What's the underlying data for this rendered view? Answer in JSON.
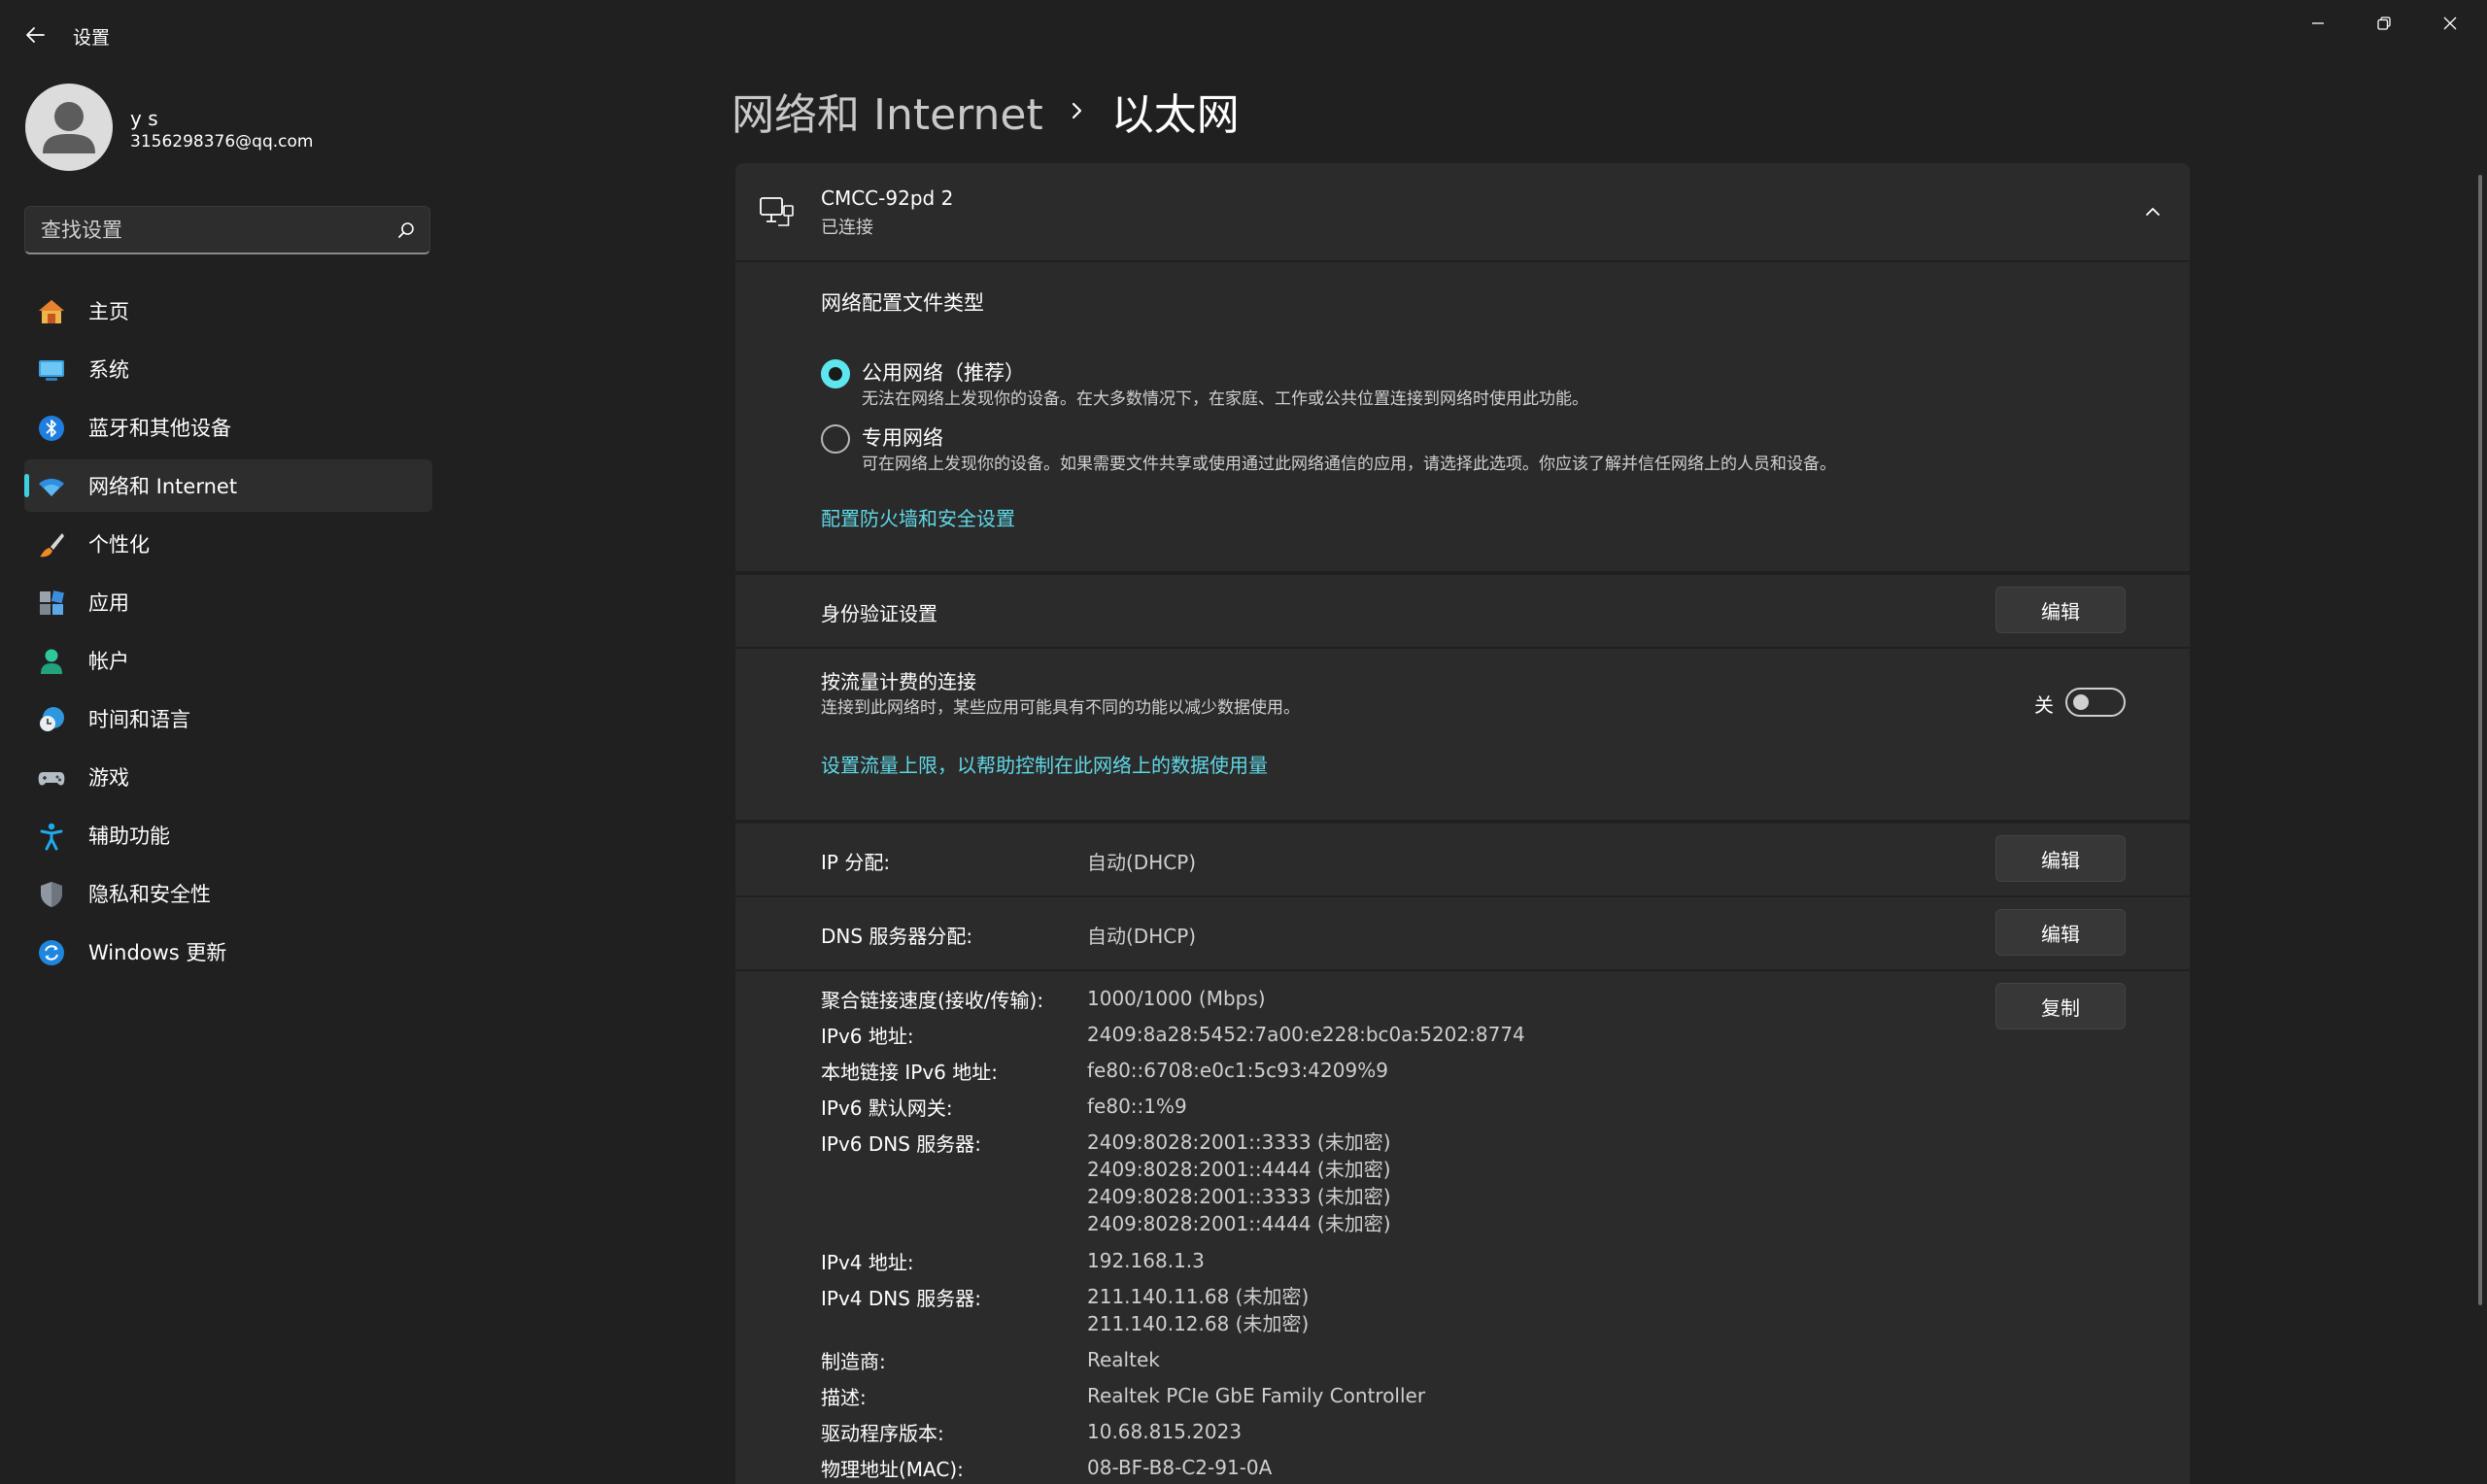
{
  "window": {
    "title": "设置"
  },
  "user": {
    "name": "y s",
    "email": "3156298376@qq.com"
  },
  "search": {
    "placeholder": "查找设置"
  },
  "sidebar": {
    "items": [
      {
        "label": "主页",
        "icon": "home-icon"
      },
      {
        "label": "系统",
        "icon": "system-icon"
      },
      {
        "label": "蓝牙和其他设备",
        "icon": "bluetooth-icon"
      },
      {
        "label": "网络和 Internet",
        "icon": "wifi-icon",
        "active": true
      },
      {
        "label": "个性化",
        "icon": "brush-icon"
      },
      {
        "label": "应用",
        "icon": "apps-icon"
      },
      {
        "label": "帐户",
        "icon": "account-icon"
      },
      {
        "label": "时间和语言",
        "icon": "clock-globe-icon"
      },
      {
        "label": "游戏",
        "icon": "gamepad-icon"
      },
      {
        "label": "辅助功能",
        "icon": "accessibility-icon"
      },
      {
        "label": "隐私和安全性",
        "icon": "shield-icon"
      },
      {
        "label": "Windows 更新",
        "icon": "update-icon"
      }
    ]
  },
  "breadcrumb": {
    "parent": "网络和 Internet",
    "current": "以太网"
  },
  "adapter": {
    "name": "CMCC-92pd 2",
    "status": "已连接"
  },
  "profile": {
    "title": "网络配置文件类型",
    "options": [
      {
        "label": "公用网络（推荐）",
        "desc": "无法在网络上发现你的设备。在大多数情况下，在家庭、工作或公共位置连接到网络时使用此功能。",
        "selected": true
      },
      {
        "label": "专用网络",
        "desc": "可在网络上发现你的设备。如果需要文件共享或使用通过此网络通信的应用，请选择此选项。你应该了解并信任网络上的人员和设备。",
        "selected": false
      }
    ],
    "firewall_link": "配置防火墙和安全设置"
  },
  "auth": {
    "label": "身份验证设置",
    "button": "编辑"
  },
  "metered": {
    "label": "按流量计费的连接",
    "desc": "连接到此网络时，某些应用可能具有不同的功能以减少数据使用。",
    "state_label": "关",
    "on": false,
    "link": "设置流量上限，以帮助控制在此网络上的数据使用量"
  },
  "ip": {
    "label": "IP 分配:",
    "value": "自动(DHCP)",
    "button": "编辑"
  },
  "dns": {
    "label": "DNS 服务器分配:",
    "value": "自动(DHCP)",
    "button": "编辑"
  },
  "properties": {
    "copy_button": "复制",
    "rows": [
      {
        "key": "聚合链接速度(接收/传输):",
        "values": [
          "1000/1000 (Mbps)"
        ]
      },
      {
        "key": "IPv6 地址:",
        "values": [
          "2409:8a28:5452:7a00:e228:bc0a:5202:8774"
        ]
      },
      {
        "key": "本地链接 IPv6 地址:",
        "values": [
          "fe80::6708:e0c1:5c93:4209%9"
        ]
      },
      {
        "key": "IPv6 默认网关:",
        "values": [
          "fe80::1%9"
        ]
      },
      {
        "key": "IPv6 DNS 服务器:",
        "values": [
          "2409:8028:2001::3333 (未加密)",
          "2409:8028:2001::4444 (未加密)",
          "2409:8028:2001::3333 (未加密)",
          "2409:8028:2001::4444 (未加密)"
        ]
      },
      {
        "key": "IPv4 地址:",
        "values": [
          "192.168.1.3"
        ]
      },
      {
        "key": "IPv4 DNS 服务器:",
        "values": [
          "211.140.11.68 (未加密)",
          "211.140.12.68 (未加密)"
        ]
      },
      {
        "key": "制造商:",
        "values": [
          "Realtek"
        ]
      },
      {
        "key": "描述:",
        "values": [
          "Realtek PCIe GbE Family Controller"
        ]
      },
      {
        "key": "驱动程序版本:",
        "values": [
          "10.68.815.2023"
        ]
      },
      {
        "key": "物理地址(MAC):",
        "values": [
          "08-BF-B8-C2-91-0A"
        ]
      }
    ]
  },
  "colors": {
    "accent": "#5fd8e6",
    "background": "#202020",
    "card": "#2b2b2b"
  }
}
